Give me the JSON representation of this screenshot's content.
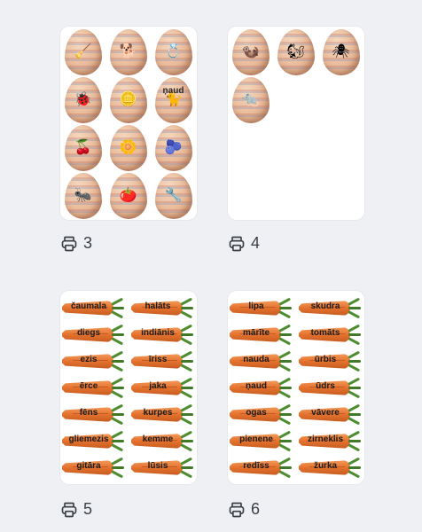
{
  "pages": [
    {
      "id": 1,
      "count": "3",
      "eggs": [
        {
          "icon": "broom-icon",
          "glyph": "🧹",
          "label": ""
        },
        {
          "icon": "dogs-icon",
          "glyph": "🐕",
          "label": ""
        },
        {
          "icon": "ring-icon",
          "glyph": "💍",
          "label": ""
        },
        {
          "icon": "ladybug-icon",
          "glyph": "🐞",
          "label": ""
        },
        {
          "icon": "coins-icon",
          "glyph": "🪙",
          "label": ""
        },
        {
          "icon": "cat-icon",
          "glyph": "🐈",
          "label": "ņaud"
        },
        {
          "icon": "fruit-bowl-icon",
          "glyph": "🍒",
          "label": ""
        },
        {
          "icon": "dandelion-icon",
          "glyph": "🌼",
          "label": ""
        },
        {
          "icon": "radish-icon",
          "glyph": "🫐",
          "label": ""
        },
        {
          "icon": "ant-icon",
          "glyph": "🐜",
          "label": ""
        },
        {
          "icon": "tomato-icon",
          "glyph": "🍅",
          "label": ""
        },
        {
          "icon": "drill-icon",
          "glyph": "🔧",
          "label": ""
        }
      ]
    },
    {
      "id": 2,
      "count": "4",
      "eggs": [
        {
          "icon": "otter-icon",
          "glyph": "🦦",
          "label": ""
        },
        {
          "icon": "squirrel-icon",
          "glyph": "🐿",
          "label": ""
        },
        {
          "icon": "spider-icon",
          "glyph": "🕷",
          "label": ""
        },
        {
          "icon": "rat-icon",
          "glyph": "🐀",
          "label": ""
        }
      ]
    },
    {
      "id": 3,
      "count": "5",
      "carrots": [
        "čaumala",
        "halāts",
        "diegs",
        "indiānis",
        "ezis",
        "īriss",
        "ērce",
        "jaka",
        "fēns",
        "kurpes",
        "gliemezis",
        "kemme",
        "gitāra",
        "lūsis"
      ]
    },
    {
      "id": 4,
      "count": "6",
      "carrots": [
        "lipa",
        "skudra",
        "mārīte",
        "tomāts",
        "nauda",
        "ūrbis",
        "ņaud",
        "ūdrs",
        "ogas",
        "vāvere",
        "pienene",
        "zirneklis",
        "redīss",
        "žurka"
      ]
    }
  ],
  "colors": {
    "background": "#eef0f4",
    "card": "#ffffff",
    "caption": "#3b3f46",
    "carrot": "#e5722e",
    "carrot_leaf": "#4d8c2f"
  },
  "caption_icon": "printer-icon"
}
